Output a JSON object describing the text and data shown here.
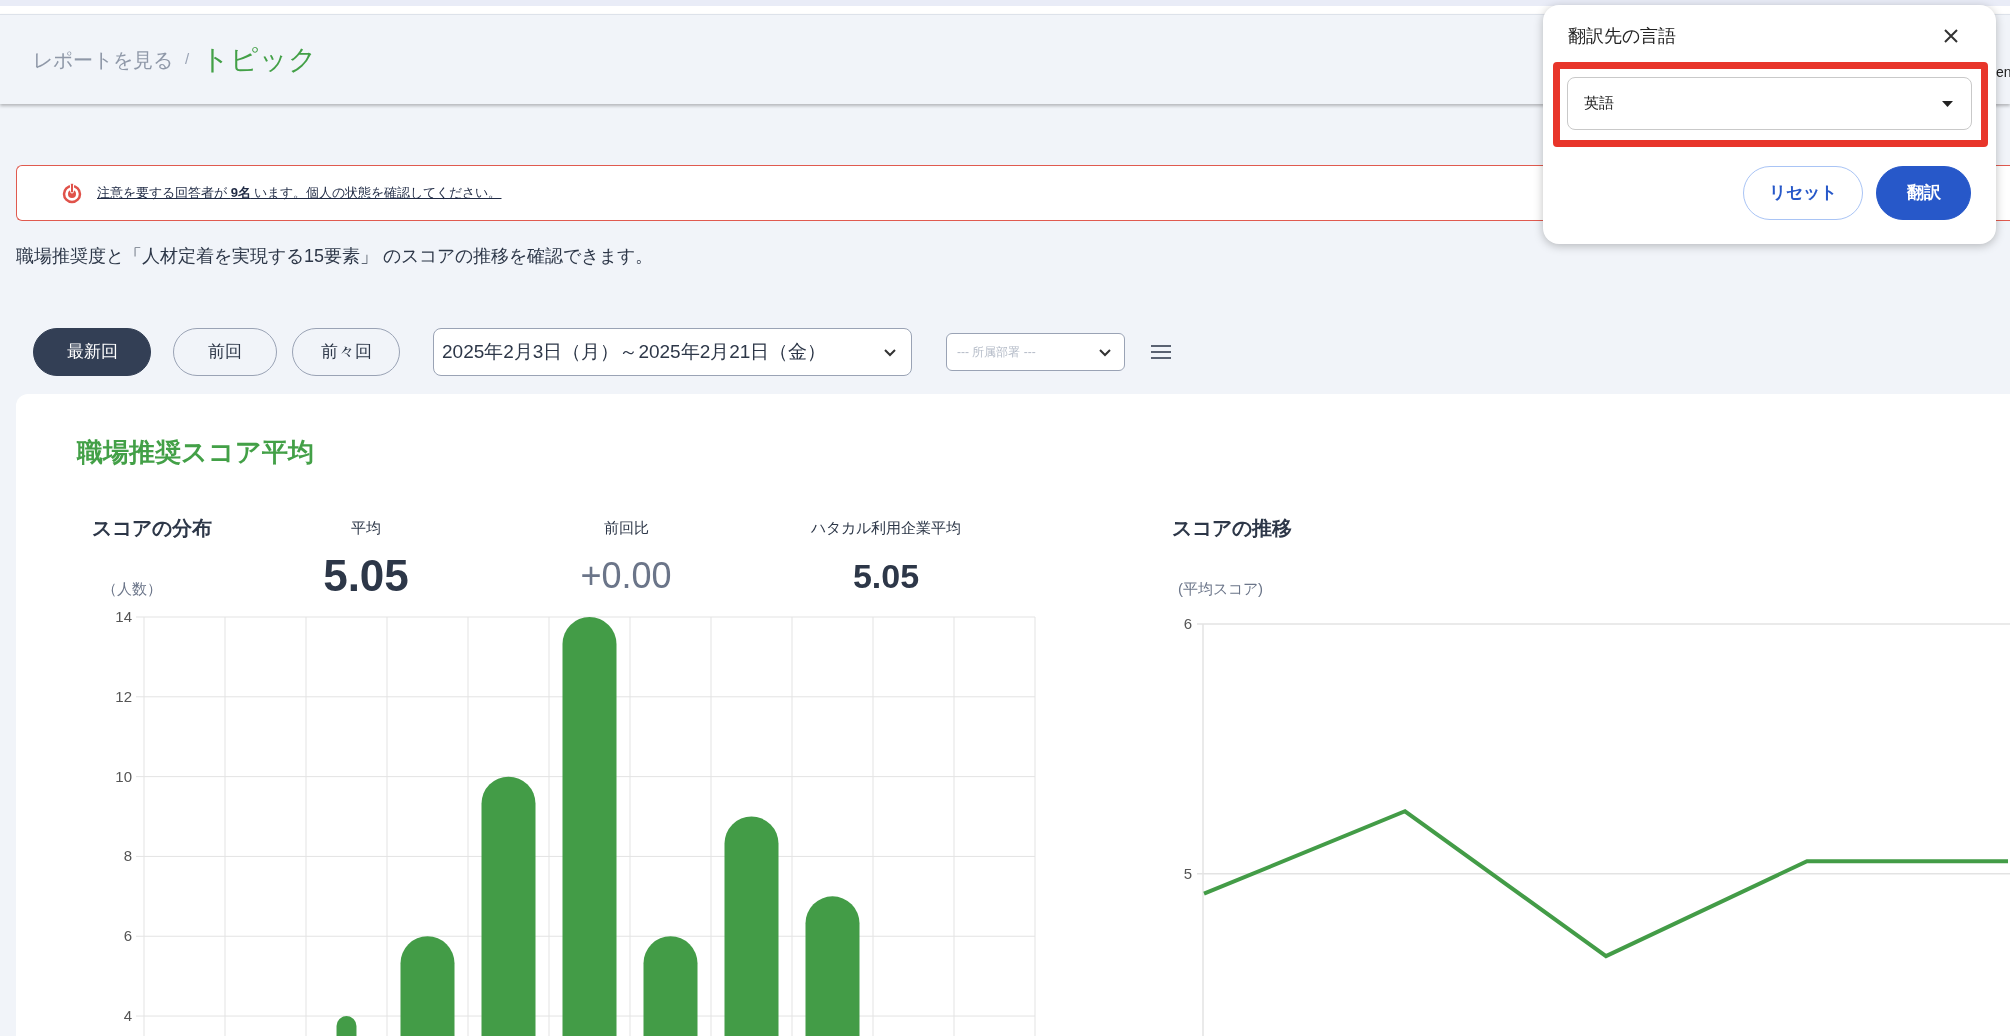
{
  "header": {
    "breadcrumbs": [
      {
        "label": "レポートを見る",
        "current": false
      },
      {
        "label": "トピック",
        "current": true
      }
    ],
    "breadcrumb_separator": "/",
    "cut_text": "en"
  },
  "alert": {
    "text": "注意を要する回答者が **9名** います。個人の状態を確認してください。"
  },
  "description": "職場推奨度と「人材定着を実現する15要素」 のスコアの推移を確認できます。",
  "period_buttons": [
    {
      "label": "最新回",
      "selected": true
    },
    {
      "label": "前回",
      "selected": false
    },
    {
      "label": "前々回",
      "selected": false
    }
  ],
  "date_range": {
    "value": "2025年2月3日（月）～2025年2月21日（金）"
  },
  "department": {
    "placeholder": "--- 所属部署 ---"
  },
  "card": {
    "title": "職場推奨スコア平均",
    "distribution": {
      "title": "スコアの分布",
      "stats": [
        {
          "label": "平均",
          "value": "5.05",
          "kind": "main"
        },
        {
          "label": "前回比",
          "value": "+0.00",
          "kind": "change"
        },
        {
          "label": "ハタカル利用企業平均",
          "value": "5.05",
          "kind": "benchmark"
        }
      ],
      "chart_data": {
        "type": "bar",
        "ylabel": "（人数）",
        "ylim": [
          3.5,
          14
        ],
        "yticks": [
          4,
          6,
          8,
          10,
          12,
          14
        ],
        "grid": true,
        "series": [
          {
            "color": "#439c47",
            "values": [
              null,
              null,
              4,
              6,
              10,
              14,
              6,
              9,
              7,
              null,
              null
            ]
          }
        ]
      }
    },
    "trend": {
      "title": "スコアの推移",
      "chart_data": {
        "type": "line",
        "ylabel": "(平均スコア)",
        "categories": [
          null,
          null,
          null,
          null,
          null
        ],
        "ylim": [
          4.35,
          6
        ],
        "yticks": [
          5,
          6
        ],
        "grid": true,
        "series": [
          {
            "color": "#439c47",
            "values": [
              4.92,
              5.25,
              4.67,
              5.05,
              5.05
            ]
          }
        ]
      }
    }
  },
  "translate_popup": {
    "title": "翻訳先の言語",
    "language": {
      "value": "英語",
      "highlighted": true
    },
    "buttons": [
      {
        "label": "リセット",
        "kind": "secondary"
      },
      {
        "label": "翻訳",
        "kind": "primary"
      }
    ]
  }
}
